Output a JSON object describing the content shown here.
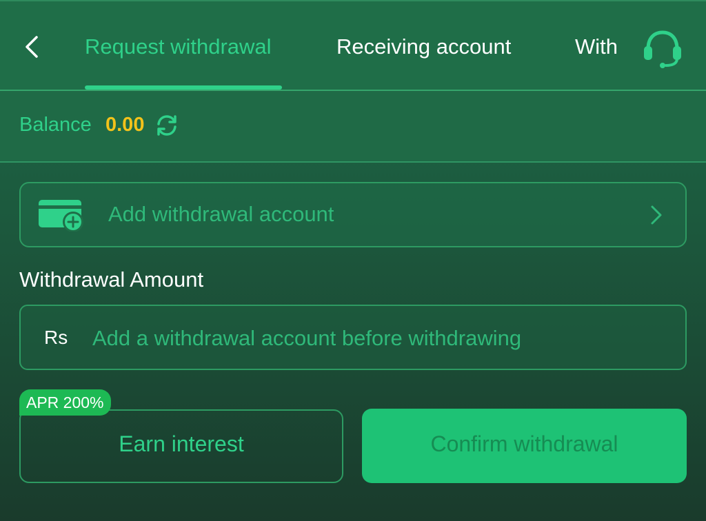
{
  "header": {
    "tabs": [
      {
        "label": "Request withdrawal",
        "active": true
      },
      {
        "label": "Receiving account",
        "active": false
      },
      {
        "label": "With",
        "active": false
      }
    ],
    "back_icon": "chevron-left-icon",
    "support_icon": "headset-icon"
  },
  "balance": {
    "label": "Balance",
    "value": "0.00",
    "refresh_icon": "refresh-icon"
  },
  "add_account": {
    "label": "Add withdrawal account",
    "icon": "wallet-add-icon",
    "chevron_icon": "chevron-right-icon"
  },
  "amount": {
    "title": "Withdrawal Amount",
    "currency": "Rs",
    "value": "",
    "placeholder": "Add a withdrawal account before withdrawing"
  },
  "earn": {
    "badge": "APR 200%",
    "label": "Earn interest"
  },
  "confirm": {
    "label": "Confirm withdrawal"
  },
  "colors": {
    "accent": "#2fd18a",
    "balance_value": "#f2c21b",
    "confirm_bg": "#1ec275",
    "badge_bg": "#1db954",
    "header_bg": "#1f6e48"
  }
}
